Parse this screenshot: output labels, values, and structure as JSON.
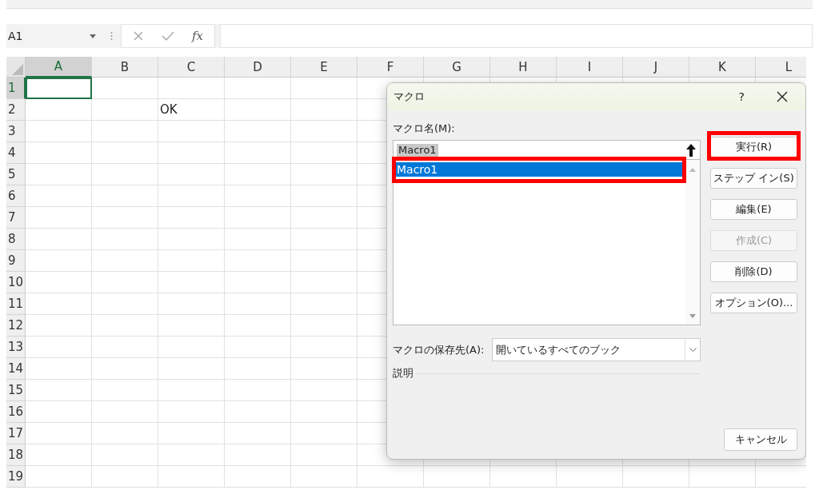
{
  "name_box": {
    "value": "A1"
  },
  "formula_bar": {
    "function_label": "fx"
  },
  "columns": [
    {
      "label": "A",
      "selected": true
    },
    {
      "label": "B",
      "selected": false
    },
    {
      "label": "C",
      "selected": false
    },
    {
      "label": "D",
      "selected": false
    },
    {
      "label": "E",
      "selected": false
    },
    {
      "label": "F",
      "selected": false
    },
    {
      "label": "G",
      "selected": false
    },
    {
      "label": "H",
      "selected": false
    },
    {
      "label": "I",
      "selected": false
    },
    {
      "label": "J",
      "selected": false
    },
    {
      "label": "K",
      "selected": false
    },
    {
      "label": "L",
      "selected": false
    }
  ],
  "rows": [
    {
      "header": "1",
      "selected": true
    },
    {
      "header": "2",
      "selected": false,
      "cells": [
        null,
        null,
        "OK"
      ]
    },
    {
      "header": "3",
      "selected": false
    },
    {
      "header": "4",
      "selected": false
    },
    {
      "header": "5",
      "selected": false
    },
    {
      "header": "6",
      "selected": false
    },
    {
      "header": "7",
      "selected": false
    },
    {
      "header": "8",
      "selected": false
    },
    {
      "header": "9",
      "selected": false
    },
    {
      "header": "10",
      "selected": false
    },
    {
      "header": "11",
      "selected": false
    },
    {
      "header": "12",
      "selected": false
    },
    {
      "header": "13",
      "selected": false
    },
    {
      "header": "14",
      "selected": false
    },
    {
      "header": "15",
      "selected": false
    },
    {
      "header": "16",
      "selected": false
    },
    {
      "header": "17",
      "selected": false
    },
    {
      "header": "18",
      "selected": false
    },
    {
      "header": "19",
      "selected": false
    }
  ],
  "dialog": {
    "title": "マクロ",
    "help": "?",
    "name_label": "マクロ名(M):",
    "name_field": {
      "value": "Macro1",
      "text_selected": true
    },
    "macro_list": [
      {
        "label": "Macro1",
        "selected": true,
        "highlighted": true
      }
    ],
    "buttons": [
      {
        "label": "実行(R)",
        "disabled": false,
        "highlighted": true
      },
      {
        "label": "ステップ イン(S)",
        "disabled": false,
        "highlighted": false
      },
      {
        "label": "編集(E)",
        "disabled": false,
        "highlighted": false
      },
      {
        "label": "作成(C)",
        "disabled": true,
        "highlighted": false
      },
      {
        "label": "削除(D)",
        "disabled": false,
        "highlighted": false
      },
      {
        "label": "オプション(O)...",
        "disabled": false,
        "highlighted": false
      }
    ],
    "location_label": "マクロの保存先(A):",
    "location_select": {
      "value": "開いているすべてのブック"
    },
    "description_label": "説明",
    "cancel_button": "キャンセル"
  }
}
